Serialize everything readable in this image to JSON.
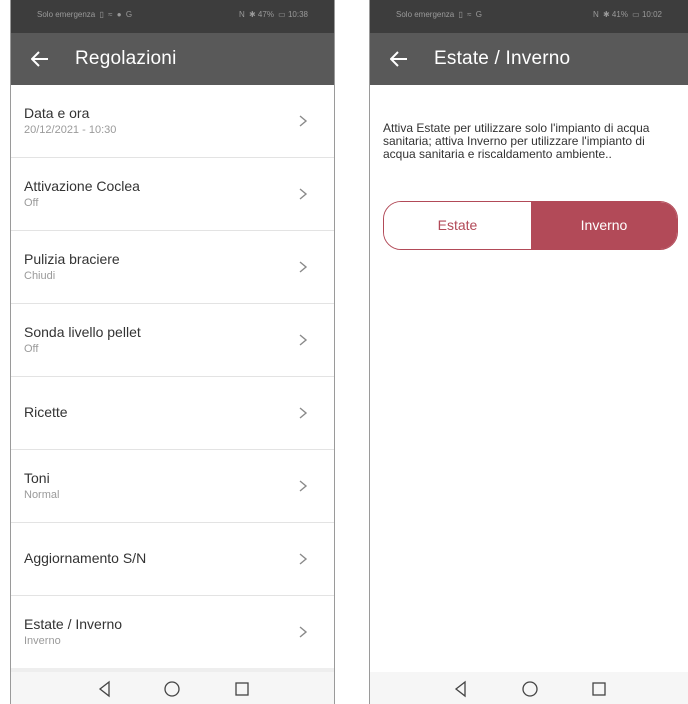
{
  "colors": {
    "accent": "#b24a58",
    "appbar": "#595959",
    "statusbar": "#3d3d3d"
  },
  "left": {
    "status": {
      "left_text": "Solo emergenza",
      "right_text": "47%",
      "time": "10:38"
    },
    "appbar": {
      "back_icon": "arrow-left-icon",
      "title": "Regolazioni"
    },
    "settings": [
      {
        "label": "Data e ora",
        "value": "20/12/2021 - 10:30"
      },
      {
        "label": "Attivazione Coclea",
        "value": "Off"
      },
      {
        "label": "Pulizia braciere",
        "value": "Chiudi"
      },
      {
        "label": "Sonda livello pellet",
        "value": "Off"
      },
      {
        "label": "Ricette"
      },
      {
        "label": "Toni",
        "value": "Normal"
      },
      {
        "label": "Aggiornamento S/N"
      },
      {
        "label": "Estate / Inverno",
        "value": "Inverno"
      }
    ]
  },
  "right": {
    "status": {
      "left_text": "Solo emergenza",
      "right_text": "41%",
      "time": "10:02"
    },
    "appbar": {
      "back_icon": "arrow-left-icon",
      "title": "Estate / Inverno"
    },
    "description": "Attiva Estate per utilizzare solo l'impianto di acqua sanitaria; attiva Inverno per utilizzare l'impianto di acqua sanitaria e riscaldamento ambiente..",
    "toggle": {
      "options": [
        "Estate",
        "Inverno"
      ],
      "selected": "Inverno"
    }
  },
  "navbar": {
    "icons": [
      "back-triangle-icon",
      "home-circle-icon",
      "recents-square-icon"
    ]
  }
}
